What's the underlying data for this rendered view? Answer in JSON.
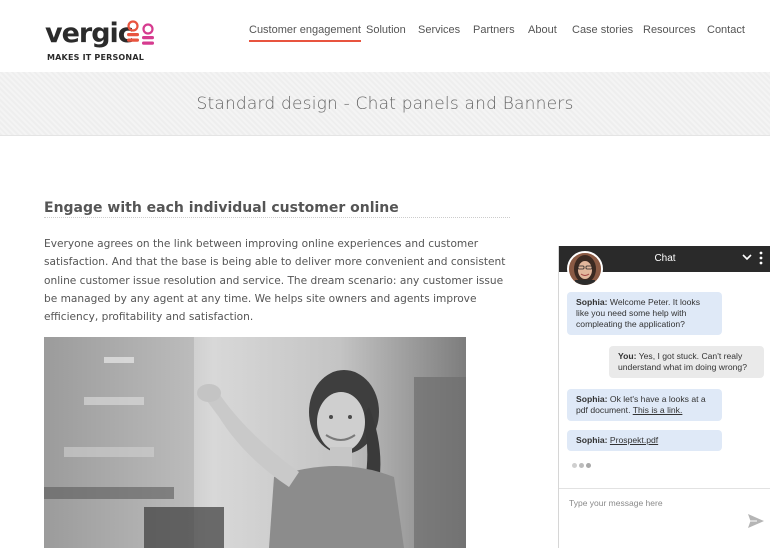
{
  "header": {
    "logo_text": "vergic",
    "logo_tagline": "MAKES IT PERSONAL",
    "nav": [
      {
        "label": "Customer engagement",
        "active": true
      },
      {
        "label": "Solution"
      },
      {
        "label": "Services"
      },
      {
        "label": "Partners"
      },
      {
        "label": "About"
      },
      {
        "label": "Case stories"
      },
      {
        "label": "Resources"
      },
      {
        "label": "Contact"
      }
    ]
  },
  "banner": {
    "title": "Standard design - Chat panels and Banners"
  },
  "content": {
    "heading": "Engage with each individual customer online",
    "paragraph": "Everyone agrees on the link between improving online experiences and customer satisfaction. And that the base is being able to deliver more convenient and consistent online customer issue resolution and service. The dream scenario: any customer issue  be managed by any agent at any time. We helps site owners and agents improve efficiency, profitability and satisfaction."
  },
  "chat": {
    "title": "Chat",
    "messages": [
      {
        "from": "Sophia:",
        "text": "Welcome Peter. It looks like you need some help with compleating the application?"
      },
      {
        "from": "You:",
        "text": "Yes, I got stuck. Can't realy understand what im doing wrong?"
      },
      {
        "from": "Sophia:",
        "text": "Ok let's have a looks at a pdf document.",
        "link": "This is a link."
      },
      {
        "from": "Sophia:",
        "link": "Prospekt.pdf"
      }
    ],
    "input_placeholder": "Type your message here"
  },
  "colors": {
    "accent": "#e8543f",
    "brand_pink": "#d63b8f",
    "agent_bubble": "#dfe9f7",
    "user_bubble": "#eaeaea",
    "chat_header": "#2a2a2a"
  },
  "icons": {
    "chat_minimize": "chevron-down-icon",
    "chat_menu": "more-vertical-icon",
    "send": "send-icon"
  }
}
